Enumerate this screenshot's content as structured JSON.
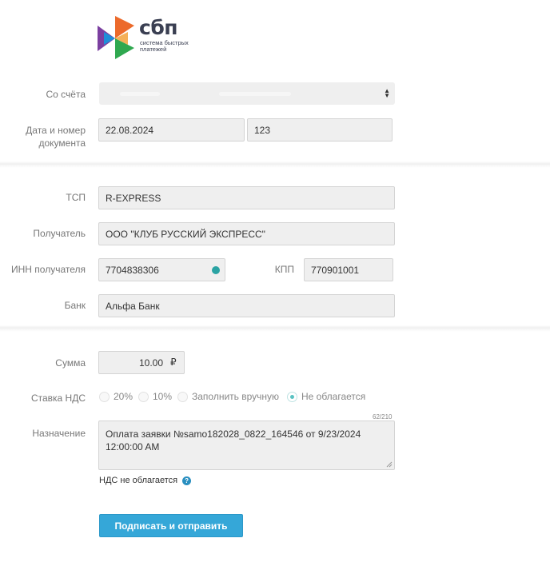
{
  "logo": {
    "brand": "сбп",
    "tagline_line1": "система быстрых",
    "tagline_line2": "платежей",
    "colors": [
      "#ec6a2b",
      "#7b3fa0",
      "#2fa84f",
      "#1f8fd8"
    ]
  },
  "section_account": {
    "from_account_label": "Со счёта",
    "doc_label_line1": "Дата и номер",
    "doc_label_line2": "документа",
    "doc_date": "22.08.2024",
    "doc_number": "123"
  },
  "section_recipient": {
    "tsp_label": "ТСП",
    "tsp_value": "R-EXPRESS",
    "recipient_label": "Получатель",
    "recipient_value": "ООО \"КЛУБ РУССКИЙ ЭКСПРЕСС\"",
    "inn_label": "ИНН получателя",
    "inn_value": "7704838306",
    "kpp_label": "КПП",
    "kpp_value": "770901001",
    "bank_label": "Банк",
    "bank_value": "Альфа Банк"
  },
  "section_payment": {
    "amount_label": "Сумма",
    "amount_value": "10.00",
    "currency_symbol": "₽",
    "vat_label": "Ставка НДС",
    "vat_options": [
      {
        "label": "20%",
        "selected": false
      },
      {
        "label": "10%",
        "selected": false
      },
      {
        "label": "Заполнить вручную",
        "selected": false
      },
      {
        "label": "Не облагается",
        "selected": true
      }
    ],
    "purpose_label": "Назначение",
    "purpose_counter": "62/210",
    "purpose_line1": "Оплата заявки №samo182028_0822_164546 от 9/23/2024",
    "purpose_line2": "12:00:00 AM",
    "vat_note": "НДС не облагается",
    "help_icon": "question-circle-icon",
    "submit_label": "Подписать и отправить",
    "accent_color": "#35a7d8"
  }
}
